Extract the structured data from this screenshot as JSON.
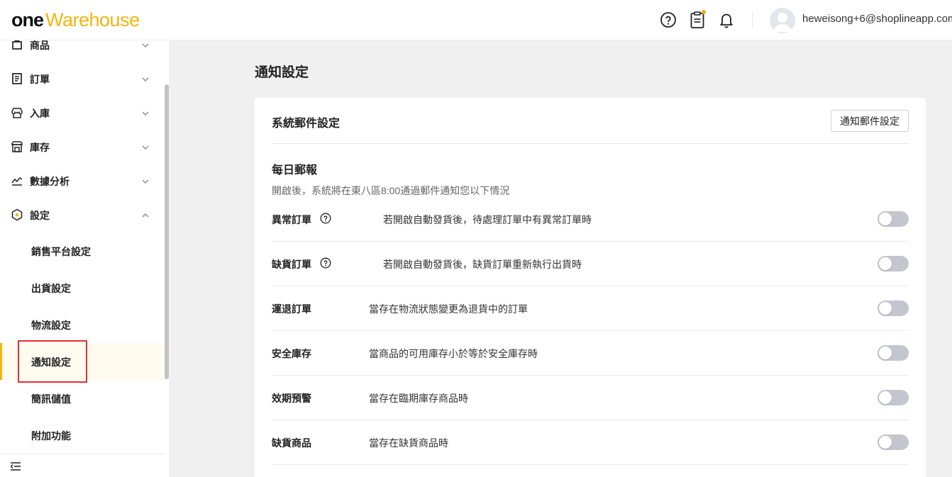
{
  "header": {
    "logo_one": "one",
    "logo_warehouse": "Warehouse",
    "icons": [
      "help-icon",
      "clipboard-icon",
      "bell-icon"
    ],
    "user_email": "heweisong+6@shoplineapp.com"
  },
  "sidebar": {
    "items": [
      {
        "label": "商品",
        "icon": "product-icon",
        "expanded": false
      },
      {
        "label": "訂單",
        "icon": "order-icon",
        "expanded": false
      },
      {
        "label": "入庫",
        "icon": "inbound-icon",
        "expanded": false
      },
      {
        "label": "庫存",
        "icon": "inventory-icon",
        "expanded": false
      },
      {
        "label": "數據分析",
        "icon": "analytics-icon",
        "expanded": false
      },
      {
        "label": "設定",
        "icon": "settings-icon",
        "expanded": true
      }
    ],
    "sub_items": [
      {
        "label": "銷售平台設定",
        "active": false
      },
      {
        "label": "出貨設定",
        "active": false
      },
      {
        "label": "物流設定",
        "active": false
      },
      {
        "label": "通知設定",
        "active": true
      },
      {
        "label": "簡訊儲值",
        "active": false
      },
      {
        "label": "附加功能",
        "active": false
      }
    ]
  },
  "main": {
    "page_title": "通知設定",
    "card": {
      "title": "系統郵件設定",
      "button_label": "通知郵件設定",
      "section_title": "每日郵報",
      "section_desc": "開啟後，系統將在東八區8:00通過郵件通知您以下情況",
      "rows": [
        {
          "label": "異常訂單",
          "has_help": true,
          "desc": "若開啟自動發貨後，待處理訂單中有異常訂單時",
          "enabled": false
        },
        {
          "label": "缺貨訂單",
          "has_help": true,
          "desc": "若開啟自動發貨後，缺貨訂單重新執行出貨時",
          "enabled": false
        },
        {
          "label": "運退訂單",
          "has_help": false,
          "desc": "當存在物流狀態變更為退貨中的訂單",
          "enabled": false
        },
        {
          "label": "安全庫存",
          "has_help": false,
          "desc": "當商品的可用庫存小於等於安全庫存時",
          "enabled": false
        },
        {
          "label": "效期預警",
          "has_help": false,
          "desc": "當存在臨期庫存商品時",
          "enabled": false
        },
        {
          "label": "缺貨商品",
          "has_help": false,
          "desc": "當存在缺貨商品時",
          "enabled": false
        }
      ]
    }
  },
  "colors": {
    "brand_yellow": "#f5b50f",
    "notification_dot": "#f5a623",
    "toggle_off": "#c3c6cd",
    "highlight_red": "#e0312f"
  }
}
